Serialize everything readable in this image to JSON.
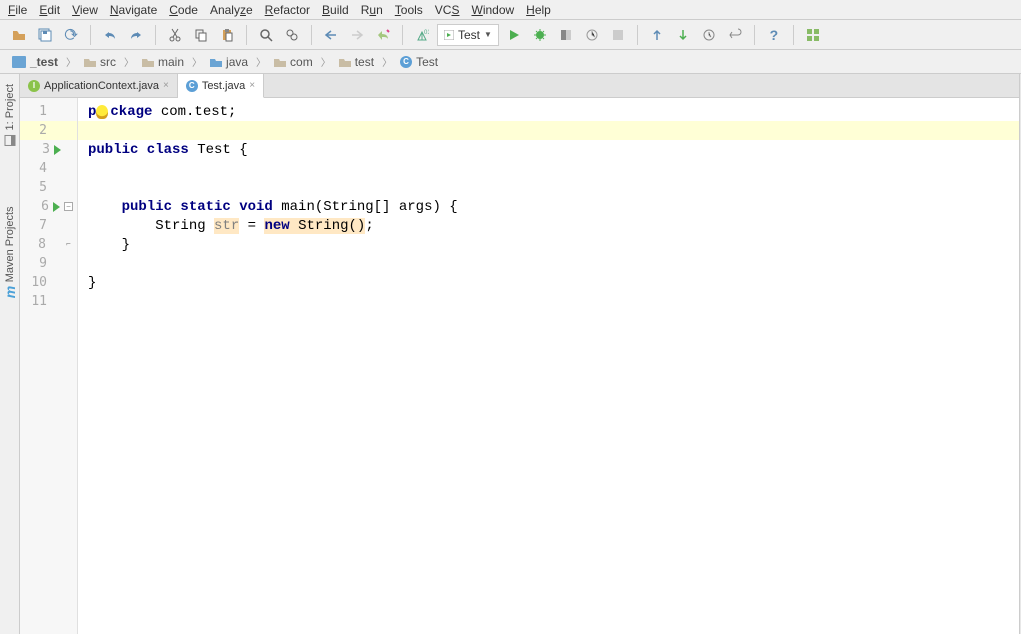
{
  "menu": {
    "file": "File",
    "edit": "Edit",
    "view": "View",
    "navigate": "Navigate",
    "code": "Code",
    "analyze": "Analyze",
    "refactor": "Refactor",
    "build": "Build",
    "run": "Run",
    "tools": "Tools",
    "vcs": "VCS",
    "window": "Window",
    "help": "Help"
  },
  "toolbar": {
    "run_config": "Test"
  },
  "breadcrumb": {
    "project": "_test",
    "src": "src",
    "main": "main",
    "java": "java",
    "com": "com",
    "test": "test",
    "class": "Test"
  },
  "sidebar": {
    "project": "1: Project",
    "maven": "Maven Projects"
  },
  "tabs": {
    "tab1": "ApplicationContext.java",
    "tab2": "Test.java"
  },
  "code": {
    "lines": [
      "1",
      "2",
      "3",
      "4",
      "5",
      "6",
      "7",
      "8",
      "9",
      "10",
      "11"
    ],
    "l1_kw": "package",
    "l1_rest": " com.test;",
    "l3": "public class",
    "l3_rest": " Test {",
    "l6_a": "public static void",
    "l6_b": " main(String[] args) {",
    "l7_a": "        String ",
    "l7_var": "str",
    "l7_b": " = ",
    "l7_new": "new",
    "l7_c": " String()",
    "l7_d": ";",
    "l8": "    }",
    "l10": "}"
  }
}
